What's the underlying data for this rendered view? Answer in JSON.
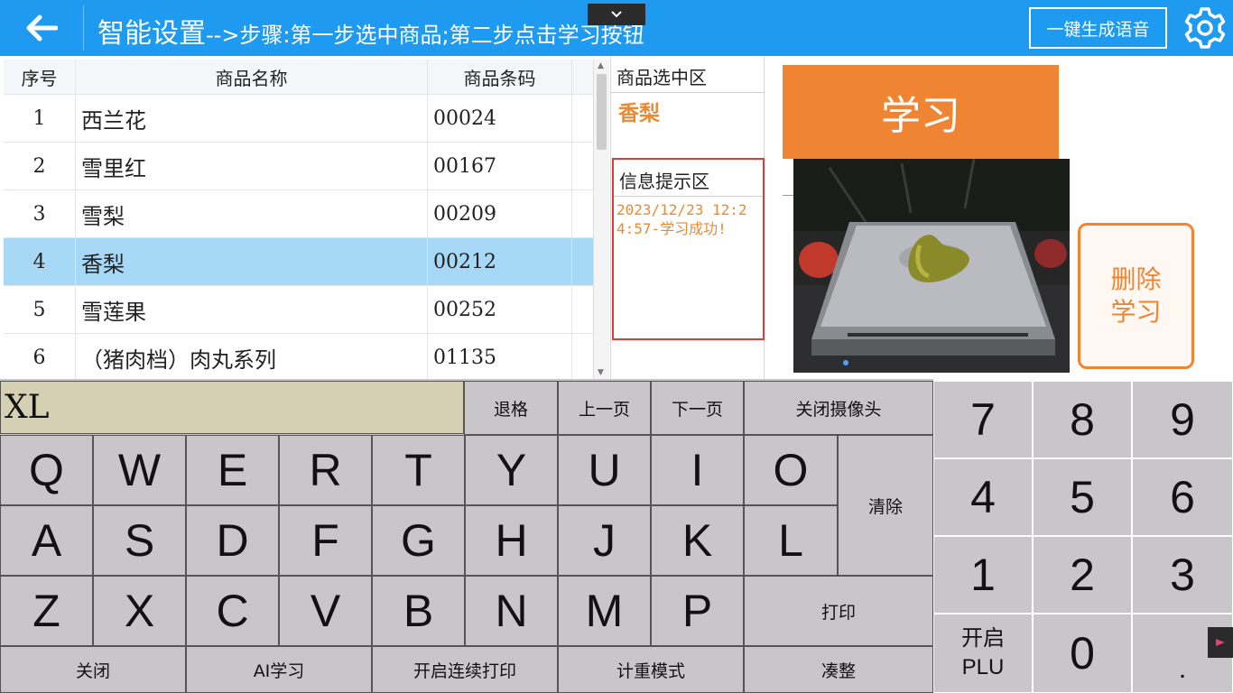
{
  "header": {
    "title": "智能设置",
    "steps": "-->步骤:第一步选中商品;第二步点击学习按钮",
    "voice_button": "一键生成语音"
  },
  "table": {
    "columns": [
      "序号",
      "商品名称",
      "商品条码"
    ],
    "rows": [
      {
        "no": "1",
        "name": "西兰花",
        "code": "00024"
      },
      {
        "no": "2",
        "name": "雪里红",
        "code": "00167"
      },
      {
        "no": "3",
        "name": "雪梨",
        "code": "00209"
      },
      {
        "no": "4",
        "name": "香梨",
        "code": "00212"
      },
      {
        "no": "5",
        "name": "雪莲果",
        "code": "00252"
      },
      {
        "no": "6",
        "name": "（猪肉档）肉丸系列",
        "code": "01135"
      }
    ],
    "selected_row": 4
  },
  "selection": {
    "label": "商品选中区",
    "value": "香梨"
  },
  "info": {
    "label": "信息提示区",
    "message": "2023/12/23 12:24:57-学习成功!"
  },
  "learn_button": "学习",
  "delete_button_line1": "删除",
  "delete_button_line2": "学习",
  "keyboard": {
    "input_value": "XL",
    "backspace": "退格",
    "prev_page": "上一页",
    "next_page": "下一页",
    "close_camera": "关闭摄像头",
    "clear": "清除",
    "print": "打印",
    "row1": [
      "Q",
      "W",
      "E",
      "R",
      "T",
      "Y",
      "U",
      "I",
      "O"
    ],
    "row2": [
      "A",
      "S",
      "D",
      "F",
      "G",
      "H",
      "J",
      "K",
      "L"
    ],
    "row3": [
      "Z",
      "X",
      "C",
      "V",
      "B",
      "N",
      "M",
      "P"
    ],
    "bottom": [
      "关闭",
      "AI学习",
      "开启连续打印",
      "计重模式",
      "凑整"
    ]
  },
  "numpad": {
    "row1": [
      "7",
      "8",
      "9"
    ],
    "row2": [
      "4",
      "5",
      "6"
    ],
    "row3": [
      "1",
      "2",
      "3"
    ],
    "plu_line1": "开启",
    "plu_line2": "PLU",
    "zero": "0",
    "dot": "."
  },
  "colors": {
    "header_bg": "#1e9bf0",
    "accent_orange": "#ef8533",
    "selected_row": "#a7d9f7",
    "info_border": "#e53935",
    "key_bg": "#c8c6c8",
    "input_bg": "#d5d0b4"
  }
}
